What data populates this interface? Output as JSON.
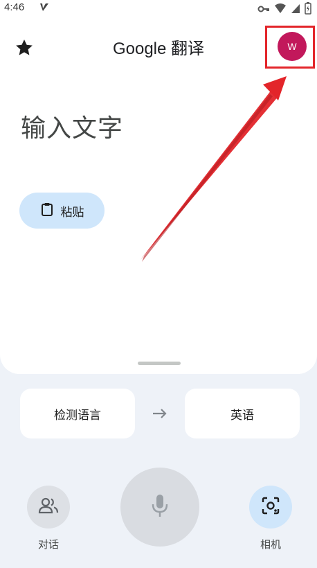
{
  "status_bar": {
    "time": "4:46"
  },
  "header": {
    "title": "Google 翻译",
    "avatar_letter": "W"
  },
  "input": {
    "placeholder": "输入文字",
    "paste_label": "粘贴"
  },
  "languages": {
    "source": "检测语言",
    "target": "英语"
  },
  "bottom_actions": {
    "conversation_label": "对话",
    "camera_label": "相机"
  },
  "colors": {
    "avatar_bg": "#c2185b",
    "highlight_red": "#e3252a",
    "paste_bg": "#cfe6fb",
    "background": "#eef2f8"
  }
}
